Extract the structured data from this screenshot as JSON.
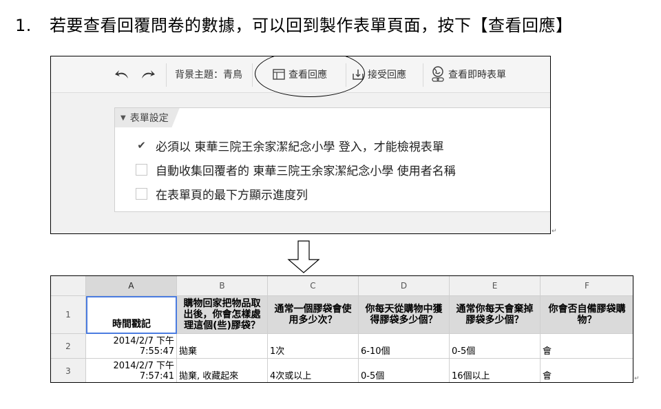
{
  "instruction": {
    "number": "1.",
    "text": "若要查看回覆問卷的數據，可以回到製作表單頁面，按下【查看回應】"
  },
  "toolbar": {
    "undo_icon": "undo-arrow-icon",
    "redo_icon": "redo-arrow-icon",
    "theme_label": "背景主題：青鳥",
    "view_responses_label": "查看回應",
    "accept_responses_label": "接受回應",
    "view_live_form_label": "查看即時表單"
  },
  "form_settings": {
    "tab_label": "表單設定",
    "options": [
      {
        "label": "必須以 東華三院王余家潔紀念小學 登入，才能檢視表單",
        "checked": true
      },
      {
        "label": "自動收集回覆者的 東華三院王余家潔紀念小學 使用者名稱",
        "checked": false
      },
      {
        "label": "在表單頁的最下方顯示進度列",
        "checked": false
      }
    ]
  },
  "sheet": {
    "columns": [
      "A",
      "B",
      "C",
      "D",
      "E",
      "F"
    ],
    "row_numbers": [
      "1",
      "2",
      "3"
    ],
    "headers": [
      "時間戳記",
      "購物回家把物品取出後，你會怎樣處理這個(些)膠袋？",
      "通常一個膠袋會使用多少次？",
      "你每天從購物中獲得膠袋多少個？",
      "通常你每天會棄掉膠袋多少個？",
      "你會否自備膠袋購物？"
    ],
    "rows": [
      {
        "ts_date": "2014/2/7 下午",
        "ts_time": "7:55:47",
        "b": "拋棄",
        "c": "1次",
        "d": "6-10個",
        "e": "0-5個",
        "f": "會"
      },
      {
        "ts_date": "2014/2/7 下午",
        "ts_time": "7:57:41",
        "b": "拋棄, 收藏起來",
        "c": "4次或以上",
        "d": "0-5個",
        "e": "16個以上",
        "f": "會"
      }
    ]
  }
}
